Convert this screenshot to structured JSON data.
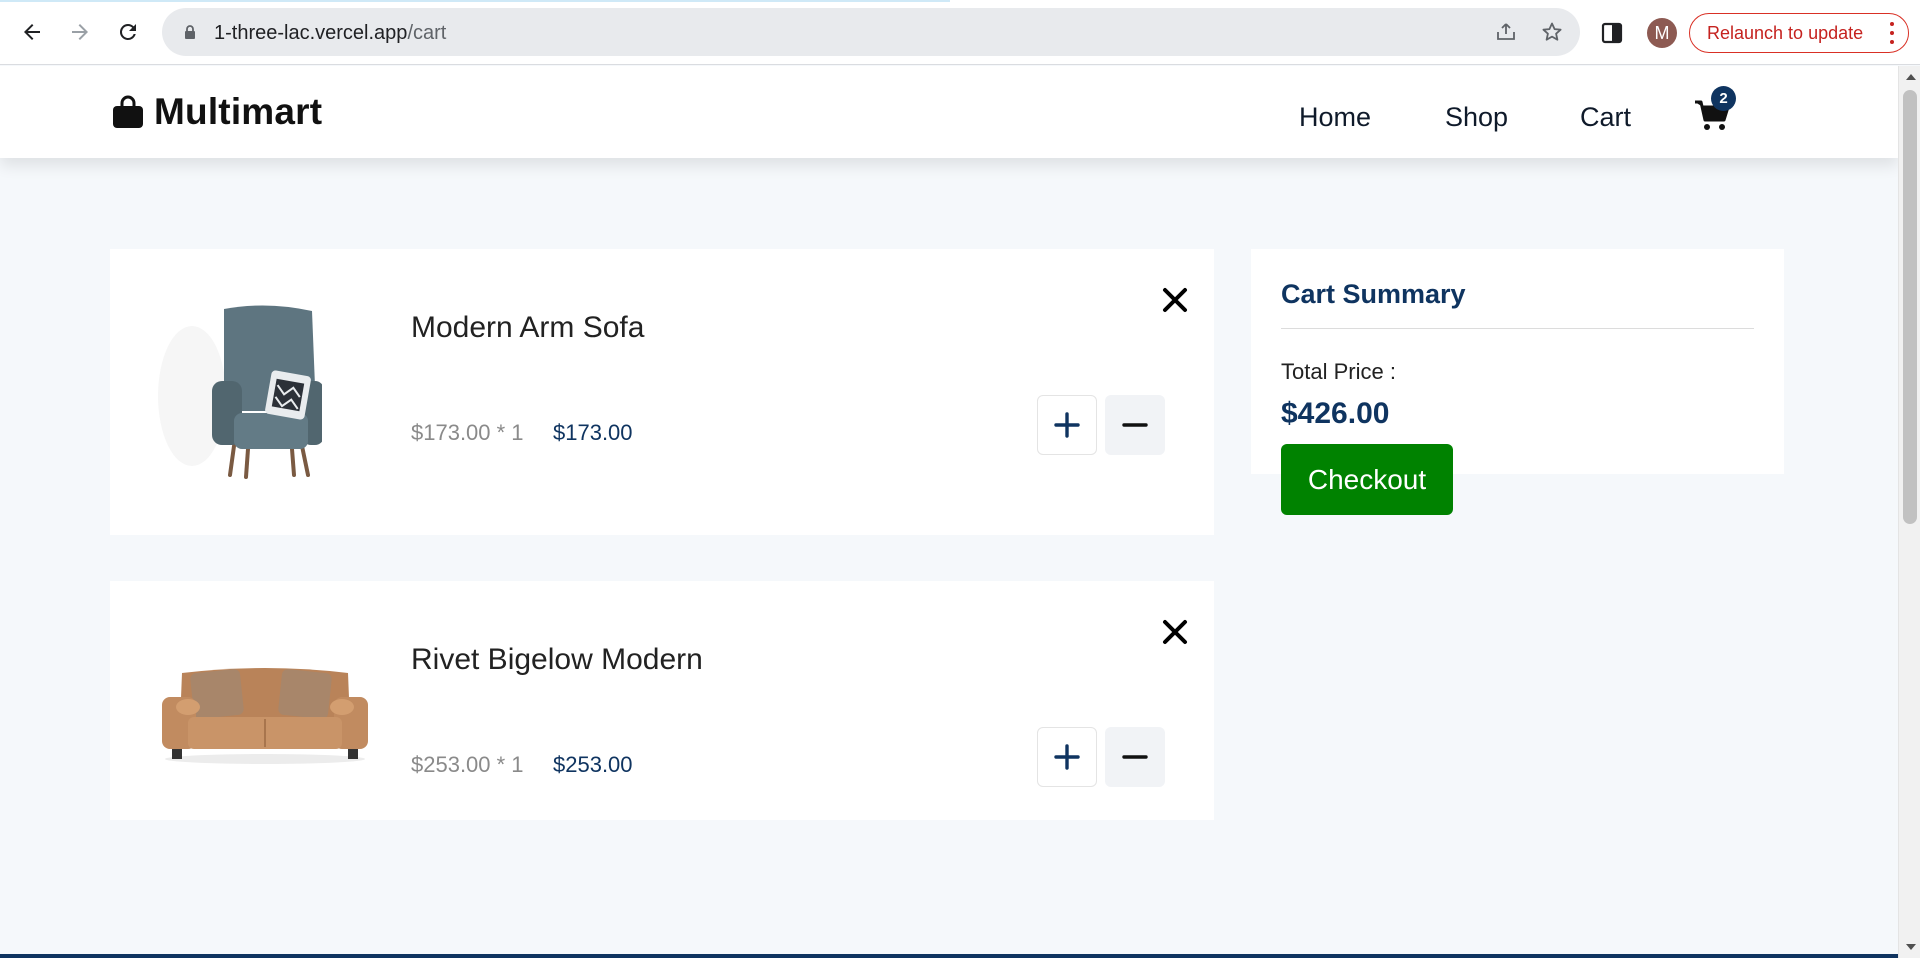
{
  "browser": {
    "url_host": "1-three-lac.vercel.app",
    "url_path": "/cart",
    "profile_initial": "M",
    "relaunch_label": "Relaunch to update"
  },
  "site": {
    "logo_text": "Multimart",
    "nav": [
      {
        "label": "Home"
      },
      {
        "label": "Shop"
      },
      {
        "label": "Cart"
      }
    ],
    "cart_count": "2"
  },
  "cart": {
    "items": [
      {
        "name": "Modern Arm Sofa",
        "unit_price_qty": "$173.00 * 1",
        "line_total": "$173.00",
        "image": "armchair-image"
      },
      {
        "name": "Rivet Bigelow Modern",
        "unit_price_qty": "$253.00 * 1",
        "line_total": "$253.00",
        "image": "sofa-image"
      }
    ]
  },
  "summary": {
    "title": "Cart Summary",
    "total_label": "Total Price :",
    "total_value": "$426.00",
    "checkout_label": "Checkout"
  },
  "colors": {
    "brand_dark": "#0f3460",
    "checkout_green": "#008200",
    "page_bg": "#f5f8fb"
  }
}
